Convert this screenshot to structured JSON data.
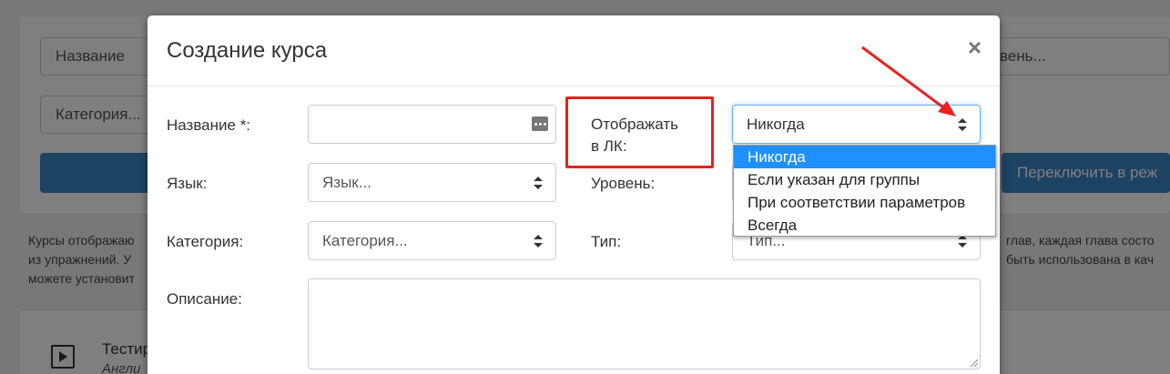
{
  "background": {
    "name_placeholder": "Название",
    "category_placeholder": "Категория...",
    "level_partial": "вень...",
    "switch_button_partial": "Переключить в реж",
    "info_left_lines": [
      "Курсы отображаю",
      "из упражнений. У",
      "можете установит"
    ],
    "info_right_lines": [
      "глав, каждая глава состо",
      "быть использована в кач"
    ],
    "list_item_title_partial": "Тестир",
    "list_item_sub_partial": "Англи"
  },
  "modal": {
    "title": "Создание курса",
    "close_label": "×",
    "fields": {
      "name_label": "Название *:",
      "language_label": "Язык:",
      "language_value": "Язык...",
      "category_label": "Категория:",
      "category_value": "Категория...",
      "description_label": "Описание:",
      "show_in_lk_label_line1": "Отображать",
      "show_in_lk_label_line2": "в ЛК:",
      "show_in_lk_value": "Никогда",
      "level_label": "Уровень:",
      "type_label": "Тип:",
      "type_value": "Тип..."
    },
    "dropdown_options": [
      "Никогда",
      "Если указан для группы",
      "При соответствии параметров",
      "Всегда"
    ],
    "selected_option_index": 0
  },
  "colors": {
    "highlight": "#e8201f",
    "selected_option": "#1e90ff",
    "primary_button": "#3a87c6"
  }
}
